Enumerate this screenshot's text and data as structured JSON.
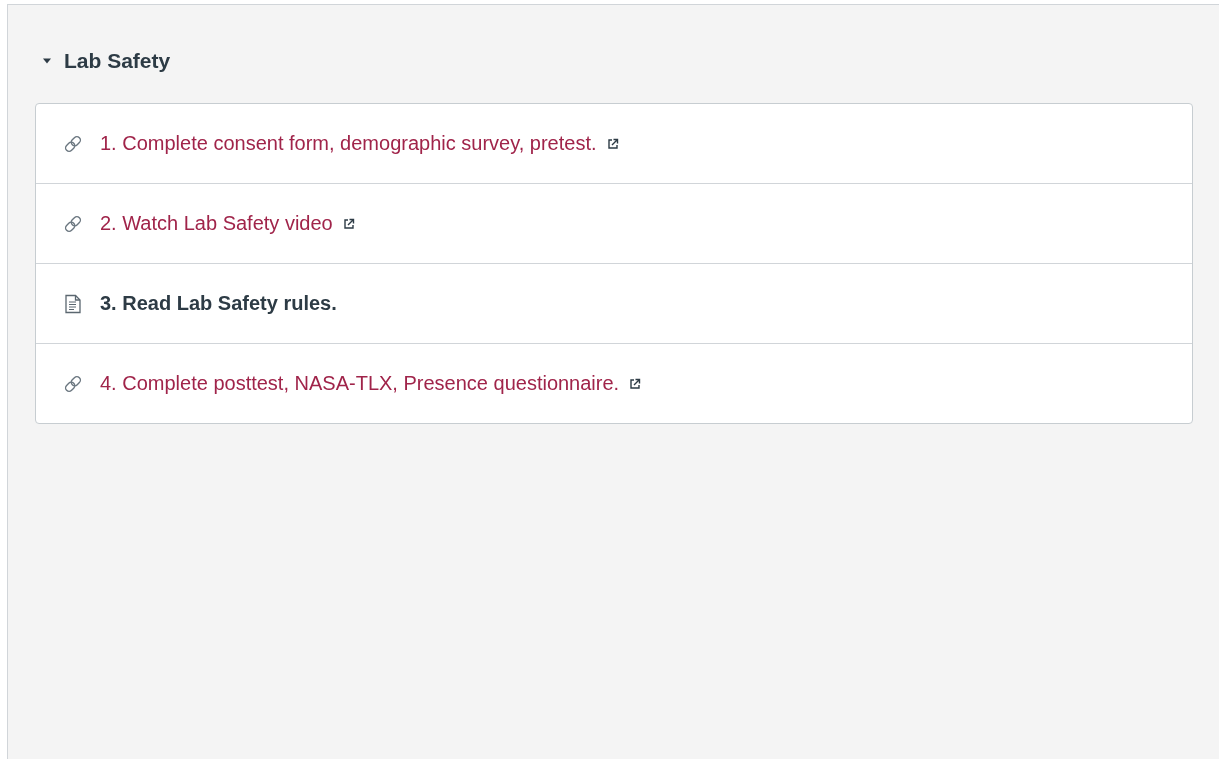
{
  "module": {
    "title": "Lab Safety",
    "expanded": true,
    "items": [
      {
        "kind": "link",
        "title": "1. Complete consent form, demographic survey, pretest."
      },
      {
        "kind": "link",
        "title": "2. Watch Lab Safety video"
      },
      {
        "kind": "page",
        "title": "3. Read Lab Safety rules."
      },
      {
        "kind": "link",
        "title": "4. Complete posttest, NASA-TLX, Presence questionnaire."
      }
    ]
  }
}
